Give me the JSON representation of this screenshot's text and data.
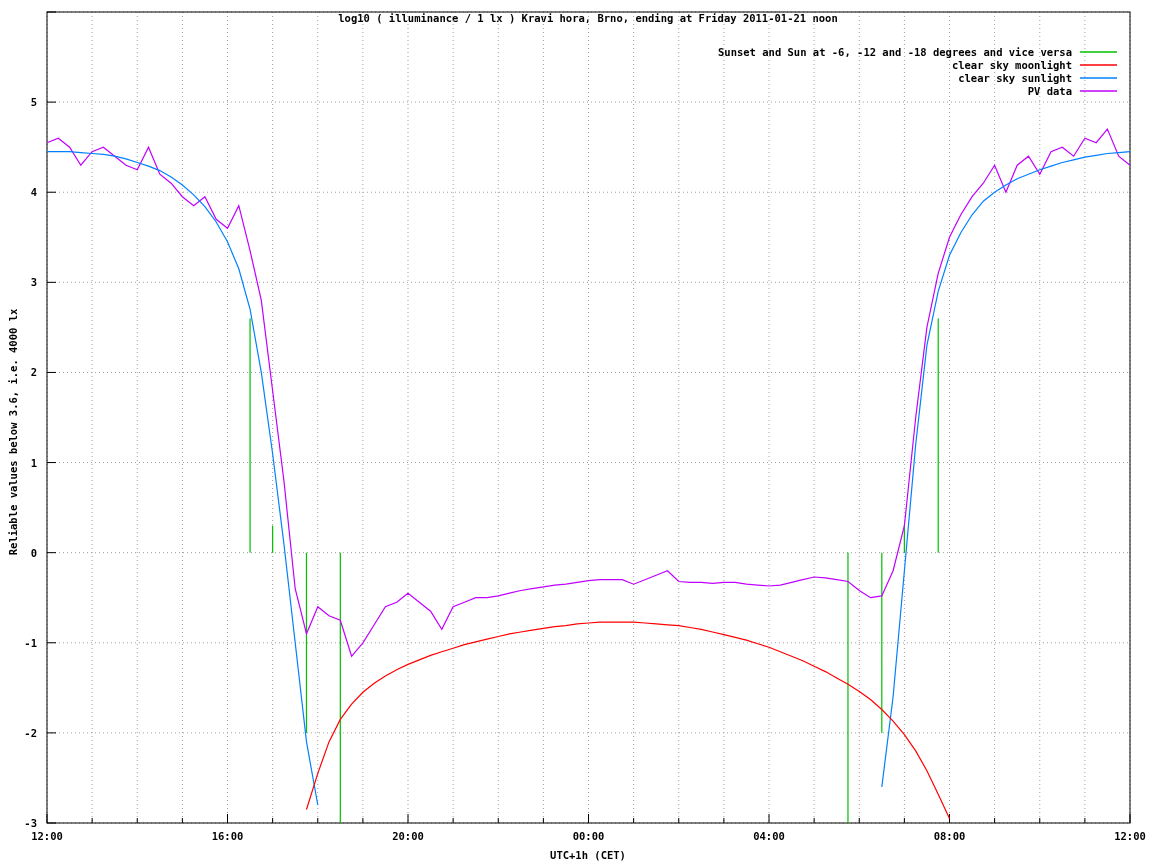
{
  "chart_data": {
    "type": "line",
    "title": "log10 ( illuminance / 1 lx ) Kravi hora, Brno, ending at Friday 2011-01-21 noon",
    "xlabel": "UTC+1h (CET)",
    "ylabel": "Reliable values below 3.6, i.e. 4000 lx",
    "ylim": [
      -3,
      6
    ],
    "grid": true,
    "legend": true,
    "yticks": [
      -3,
      -2,
      -1,
      0,
      1,
      2,
      3,
      4,
      5
    ],
    "categories": [
      "12:00",
      null,
      null,
      null,
      null,
      null,
      null,
      null,
      null,
      null,
      null,
      null,
      null,
      null,
      null,
      null,
      "16:00",
      null,
      null,
      null,
      null,
      null,
      null,
      null,
      null,
      null,
      null,
      null,
      null,
      null,
      null,
      null,
      "20:00",
      null,
      null,
      null,
      null,
      null,
      null,
      null,
      null,
      null,
      null,
      null,
      null,
      null,
      null,
      null,
      "00:00",
      null,
      null,
      null,
      null,
      null,
      null,
      null,
      null,
      null,
      null,
      null,
      null,
      null,
      null,
      null,
      "04:00",
      null,
      null,
      null,
      null,
      null,
      null,
      null,
      null,
      null,
      null,
      null,
      null,
      null,
      null,
      null,
      "08:00",
      null,
      null,
      null,
      null,
      null,
      null,
      null,
      null,
      null,
      null,
      null,
      null,
      null,
      null,
      null,
      "12:00"
    ],
    "series": [
      {
        "name": "Sunset and Sun at -6, -12 and -18 degrees and vice versa",
        "color": "#00c000",
        "type": "bar",
        "values": [
          null,
          null,
          null,
          null,
          null,
          null,
          null,
          null,
          null,
          null,
          null,
          null,
          null,
          null,
          null,
          null,
          null,
          null,
          2.6,
          null,
          0.3,
          null,
          null,
          -2,
          null,
          null,
          -3,
          null,
          null,
          null,
          null,
          null,
          null,
          null,
          null,
          null,
          null,
          null,
          null,
          null,
          null,
          null,
          null,
          null,
          null,
          null,
          null,
          null,
          null,
          null,
          null,
          null,
          null,
          null,
          null,
          null,
          null,
          null,
          null,
          null,
          null,
          null,
          null,
          null,
          null,
          null,
          null,
          null,
          null,
          null,
          null,
          -3,
          null,
          null,
          -2,
          null,
          0.3,
          null,
          null,
          2.6,
          null,
          null,
          null,
          null,
          null,
          null,
          null,
          null,
          null,
          null,
          null,
          null,
          null,
          null,
          null,
          null,
          null
        ]
      },
      {
        "name": "clear sky moonlight",
        "color": "#ff0000",
        "values": [
          null,
          null,
          null,
          null,
          null,
          null,
          null,
          null,
          null,
          null,
          null,
          null,
          null,
          null,
          null,
          null,
          null,
          null,
          null,
          null,
          null,
          null,
          null,
          -2.85,
          -2.45,
          -2.1,
          -1.85,
          -1.68,
          -1.55,
          -1.45,
          -1.37,
          -1.3,
          -1.24,
          -1.19,
          -1.14,
          -1.1,
          -1.06,
          -1.02,
          -0.99,
          -0.96,
          -0.93,
          -0.9,
          -0.88,
          -0.86,
          -0.84,
          -0.82,
          -0.81,
          -0.79,
          -0.78,
          -0.77,
          -0.77,
          -0.77,
          -0.77,
          -0.78,
          -0.79,
          -0.8,
          -0.81,
          -0.83,
          -0.85,
          -0.88,
          -0.91,
          -0.94,
          -0.97,
          -1.01,
          -1.05,
          -1.1,
          -1.15,
          -1.2,
          -1.26,
          -1.32,
          -1.39,
          -1.46,
          -1.54,
          -1.63,
          -1.74,
          -1.87,
          -2.02,
          -2.2,
          -2.42,
          -2.68,
          -2.95,
          null,
          null,
          null,
          null,
          null,
          null,
          null,
          null,
          null,
          null,
          null,
          null,
          null,
          null,
          null,
          null
        ]
      },
      {
        "name": "clear sky sunlight",
        "color": "#0080ff",
        "values": [
          4.45,
          4.45,
          4.45,
          4.44,
          4.43,
          4.42,
          4.4,
          4.37,
          4.33,
          4.29,
          4.24,
          4.17,
          4.08,
          3.97,
          3.84,
          3.67,
          3.45,
          3.15,
          2.7,
          2.0,
          1.1,
          0.1,
          -1.0,
          -2.1,
          -2.8,
          null,
          null,
          null,
          null,
          null,
          null,
          null,
          null,
          null,
          null,
          null,
          null,
          null,
          null,
          null,
          null,
          null,
          null,
          null,
          null,
          null,
          null,
          null,
          null,
          null,
          null,
          null,
          null,
          null,
          null,
          null,
          null,
          null,
          null,
          null,
          null,
          null,
          null,
          null,
          null,
          null,
          null,
          null,
          null,
          null,
          null,
          null,
          null,
          null,
          -2.6,
          -1.6,
          -0.2,
          1.2,
          2.3,
          2.9,
          3.3,
          3.55,
          3.75,
          3.9,
          4.0,
          4.08,
          4.15,
          4.2,
          4.25,
          4.29,
          4.33,
          4.36,
          4.39,
          4.41,
          4.43,
          4.44,
          4.45
        ]
      },
      {
        "name": "PV data",
        "color": "#c000ff",
        "values": [
          4.55,
          4.6,
          4.5,
          4.3,
          4.45,
          4.5,
          4.4,
          4.3,
          4.25,
          4.5,
          4.2,
          4.1,
          3.95,
          3.85,
          3.95,
          3.7,
          3.6,
          3.85,
          3.35,
          2.8,
          1.8,
          0.8,
          -0.4,
          -0.9,
          -0.6,
          -0.7,
          -0.75,
          -1.15,
          -1.0,
          -0.8,
          -0.6,
          -0.55,
          -0.45,
          -0.55,
          -0.65,
          -0.85,
          -0.6,
          -0.55,
          -0.5,
          -0.5,
          -0.48,
          -0.45,
          -0.42,
          -0.4,
          -0.38,
          -0.36,
          -0.35,
          -0.33,
          -0.31,
          -0.3,
          -0.3,
          -0.3,
          -0.35,
          -0.3,
          -0.25,
          -0.2,
          -0.32,
          -0.33,
          -0.33,
          -0.34,
          -0.33,
          -0.33,
          -0.35,
          -0.36,
          -0.37,
          -0.36,
          -0.33,
          -0.3,
          -0.27,
          -0.28,
          -0.3,
          -0.32,
          -0.42,
          -0.5,
          -0.48,
          -0.2,
          0.3,
          1.5,
          2.5,
          3.1,
          3.5,
          3.75,
          3.95,
          4.1,
          4.3,
          4.0,
          4.3,
          4.4,
          4.2,
          4.45,
          4.5,
          4.4,
          4.6,
          4.55,
          4.7,
          4.4,
          4.3
        ]
      }
    ]
  }
}
